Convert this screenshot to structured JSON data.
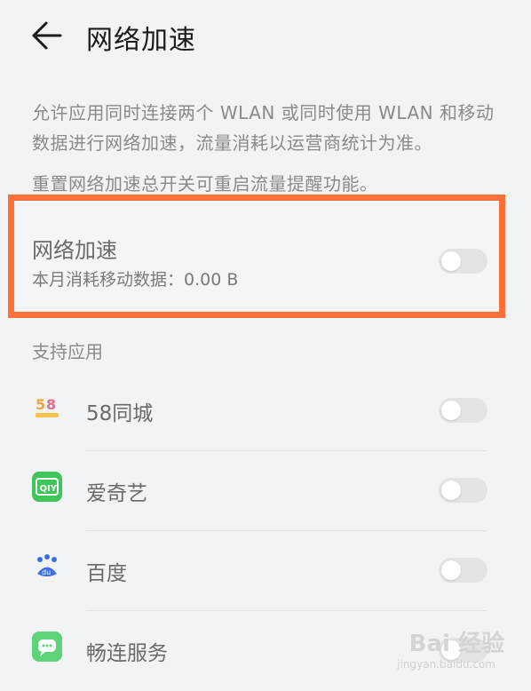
{
  "header": {
    "title": "网络加速"
  },
  "description": {
    "line1": "允许应用同时连接两个 WLAN 或同时使用 WLAN 和移动数据进行网络加速，流量消耗以运营商统计为准。",
    "line2": "重置网络加速总开关可重启流量提醒功能。"
  },
  "main_toggle": {
    "title": "网络加速",
    "subtitle": "本月消耗移动数据：0.00 B",
    "enabled": false
  },
  "apps_section": {
    "header": "支持应用",
    "apps": [
      {
        "name": "58同城",
        "icon": "58-icon",
        "enabled": false
      },
      {
        "name": "爱奇艺",
        "icon": "iqiyi-icon",
        "enabled": false
      },
      {
        "name": "百度",
        "icon": "baidu-icon",
        "enabled": false
      },
      {
        "name": "畅连服务",
        "icon": "changlian-icon",
        "enabled": false
      }
    ]
  },
  "watermark": {
    "text": "Bai 经验",
    "sub": "jingyan.baidu.com"
  },
  "colors": {
    "highlight_border": "#ff7038",
    "toggle_off": "#e2e3e5",
    "iqiyi_green": "#3ec65a",
    "changlian_green": "#5fd37a"
  }
}
